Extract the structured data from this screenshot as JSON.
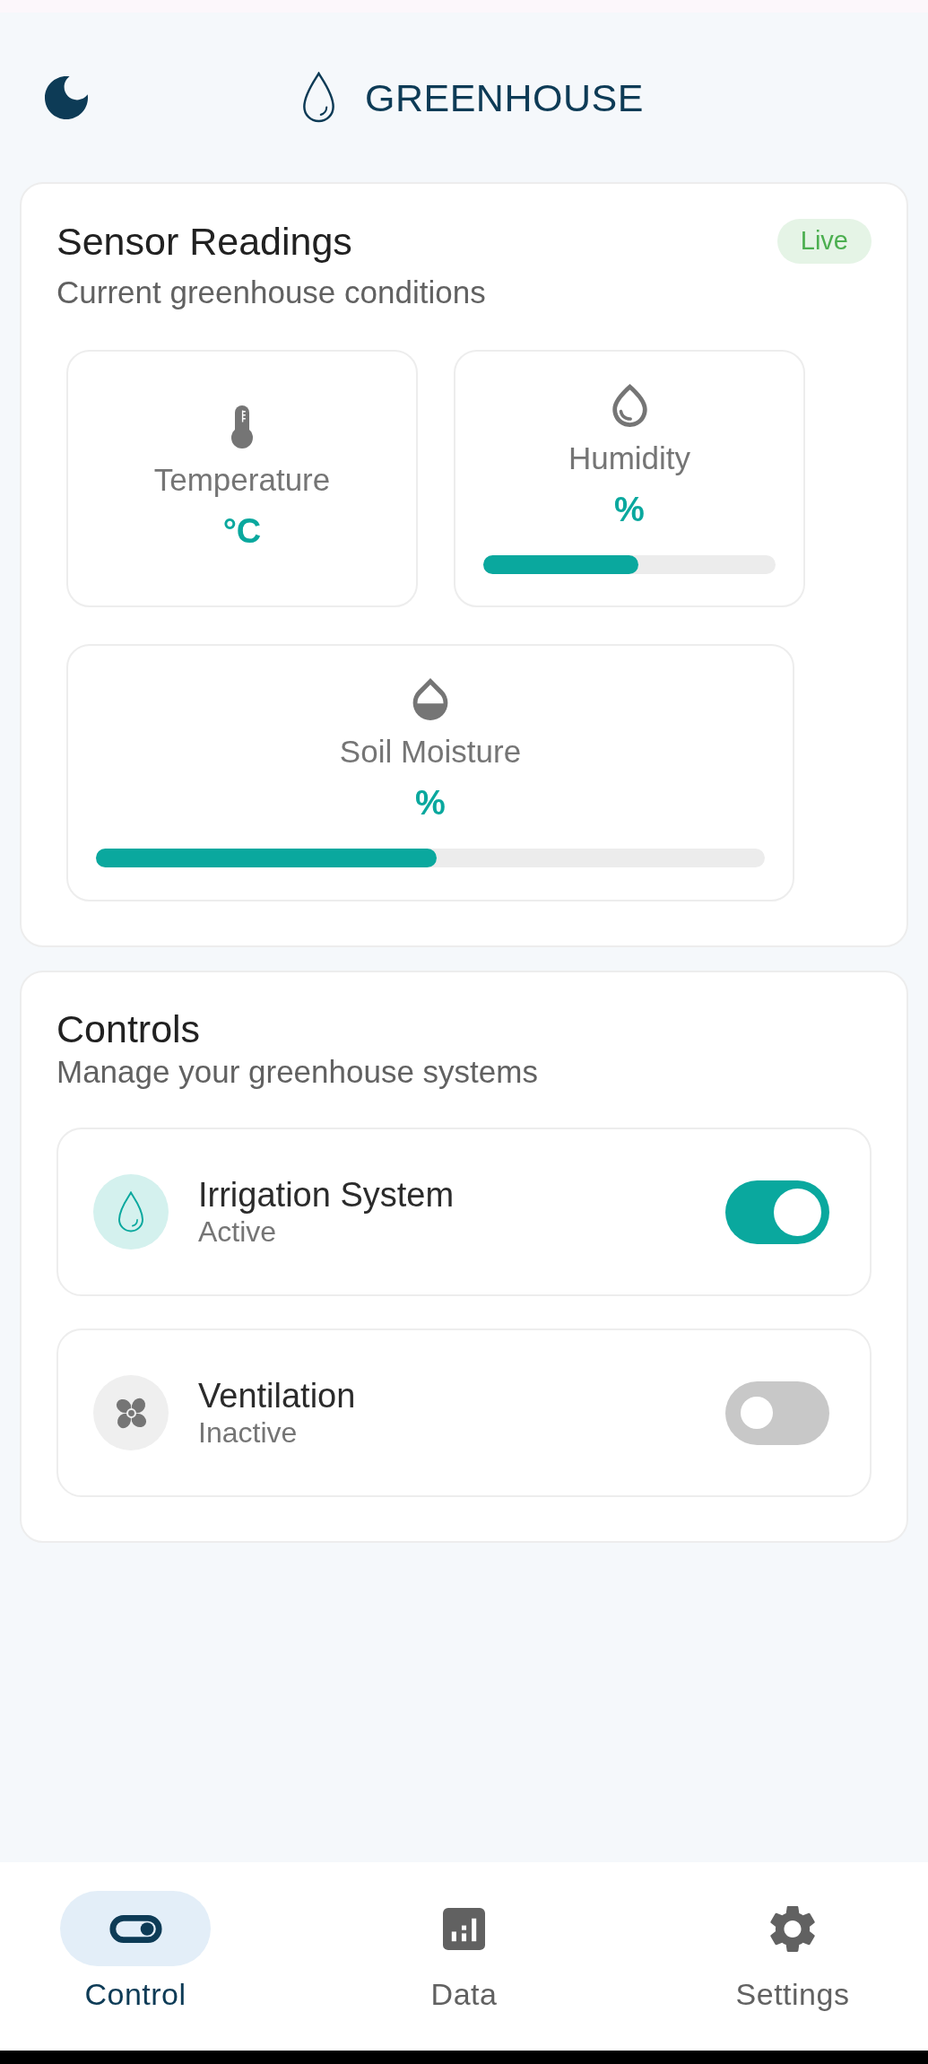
{
  "header": {
    "title": "GREENHOUSE"
  },
  "sensor_readings": {
    "title": "Sensor Readings",
    "subtitle": "Current greenhouse conditions",
    "badge": "Live",
    "sensors": [
      {
        "kind": "temperature",
        "label": "Temperature",
        "value": "°C"
      },
      {
        "kind": "humidity",
        "label": "Humidity",
        "value": "%",
        "level": 0.53
      },
      {
        "kind": "soil_moisture",
        "label": "Soil Moisture",
        "value": "%",
        "level": 0.51
      }
    ]
  },
  "controls": {
    "title": "Controls",
    "subtitle": "Manage your greenhouse systems",
    "items": [
      {
        "kind": "irrigation",
        "name": "Irrigation System",
        "status": "Active",
        "on": true
      },
      {
        "kind": "ventilation",
        "name": "Ventilation",
        "status": "Inactive",
        "on": false
      }
    ]
  },
  "bottom_nav": [
    {
      "kind": "control",
      "label": "Control",
      "selected": true
    },
    {
      "kind": "data",
      "label": "Data",
      "selected": false
    },
    {
      "kind": "settings",
      "label": "Settings",
      "selected": false
    }
  ]
}
